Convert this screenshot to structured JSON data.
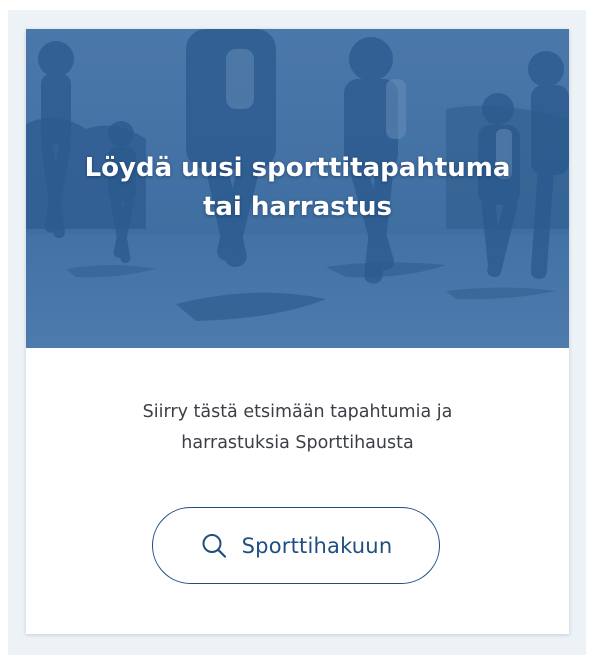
{
  "hero": {
    "title_line1": "Löydä uusi sporttitapahtuma",
    "title_line2": "tai harrastus"
  },
  "description": {
    "line1": "Siirry tästä etsimään tapahtumia ja",
    "line2": "harrastuksia Sporttihausta"
  },
  "cta": {
    "label": "Sporttihakuun",
    "icon": "search-icon"
  },
  "colors": {
    "accent": "#1f4f7f",
    "hero_overlay": "#2e5f94",
    "panel_background": "#edf2f7",
    "card_background": "#ffffff",
    "body_text": "#3b3f45"
  }
}
